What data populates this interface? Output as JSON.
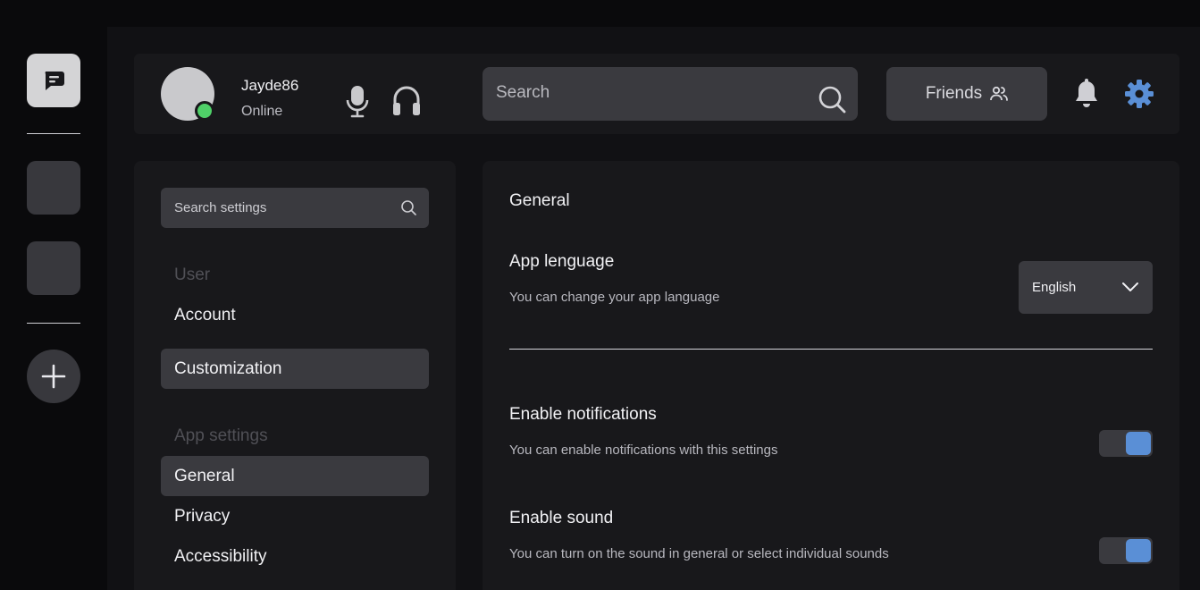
{
  "colors": {
    "accent": "#5a8fd6",
    "online": "#4fd068",
    "surface": "#18181b",
    "control": "#3a3a3f"
  },
  "rail": {
    "icons": [
      "chat-bubble-icon",
      "server-icon",
      "server-icon",
      "plus-icon"
    ]
  },
  "user": {
    "name": "Jayde86",
    "status": "Online"
  },
  "topbar": {
    "search_placeholder": "Search",
    "friends_label": "Friends",
    "icons": [
      "microphone-icon",
      "headphones-icon",
      "search-icon",
      "friends-icon",
      "bell-icon",
      "gear-icon"
    ]
  },
  "sidebar": {
    "search_placeholder": "Search settings",
    "sections": [
      {
        "title": "User",
        "items": [
          {
            "label": "Account",
            "selected": false
          },
          {
            "label": "Customization",
            "selected": true
          }
        ]
      },
      {
        "title": "App settings",
        "items": [
          {
            "label": "General",
            "selected": true
          },
          {
            "label": "Privacy",
            "selected": false
          },
          {
            "label": "Accessibility",
            "selected": false
          }
        ]
      }
    ]
  },
  "content": {
    "heading": "General",
    "language": {
      "title": "App lenguage",
      "description": "You can change your app language",
      "value": "English"
    },
    "notifications": {
      "title": "Enable notifications",
      "description": "You can enable notifications with this settings",
      "enabled": true
    },
    "sound": {
      "title": "Enable sound",
      "description": "You can turn on the sound in general or select individual sounds",
      "enabled": true
    }
  }
}
